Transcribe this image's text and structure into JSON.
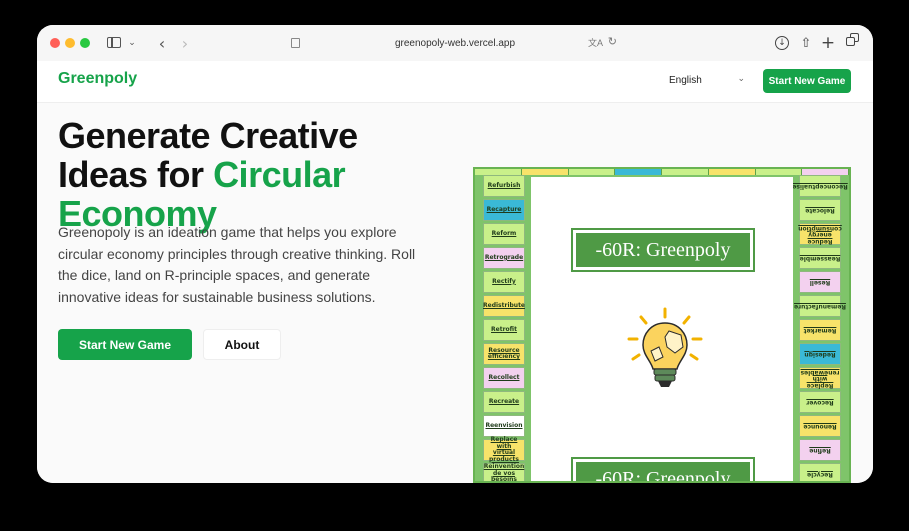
{
  "browser": {
    "url": "greenopoly-web.vercel.app",
    "icons": [
      "sidebar-icon",
      "chevron-down-icon",
      "back-icon",
      "forward-icon",
      "page-icon",
      "translate-icon",
      "reload-icon",
      "download-icon",
      "share-icon",
      "plus-icon",
      "tabs-icon"
    ]
  },
  "header": {
    "logo": "Greenpoly",
    "language": "English",
    "cta": "Start New Game"
  },
  "hero": {
    "title_line1": "Generate Creative",
    "title_line2_a": "Ideas for ",
    "title_line2_b": "Circular",
    "title_line3": "Economy",
    "description": "Greenopoly is an ideation game that helps you explore circular economy principles through creative thinking. Roll the dice, land on R-principle spaces, and generate innovative ideas for sustainable business solutions.",
    "primary_button": "Start New Game",
    "secondary_button": "About"
  },
  "board": {
    "label": "-60R: Greenpoly",
    "left_tiles": [
      {
        "text": "Refurbish",
        "color": "#c9f08a"
      },
      {
        "text": "Recapture",
        "color": "#3ab9d6"
      },
      {
        "text": "Reform",
        "color": "#c9f08a"
      },
      {
        "text": "Retrograde",
        "color": "#f3d1ef"
      },
      {
        "text": "Rectify",
        "color": "#c9f08a"
      },
      {
        "text": "Redistribute",
        "color": "#f7e36a"
      },
      {
        "text": "Retrofit",
        "color": "#c9f08a"
      },
      {
        "text": "Resource efficiency",
        "color": "#f7e36a"
      },
      {
        "text": "Recollect",
        "color": "#f3d1ef"
      },
      {
        "text": "Recreate",
        "color": "#c9f08a"
      },
      {
        "text": "Reenvision",
        "color": "#ffffff"
      },
      {
        "text": "Replace with virtual products",
        "color": "#f7e36a"
      },
      {
        "text": "Reinvention de vos besoins",
        "color": "#c9f08a"
      }
    ],
    "right_tiles": [
      {
        "text": "Reconceptualise",
        "color": "#c9f08a"
      },
      {
        "text": "Relocate",
        "color": "#c9f08a"
      },
      {
        "text": "Reduce energy consumption",
        "color": "#f7e36a"
      },
      {
        "text": "Reassemble",
        "color": "#c9f08a"
      },
      {
        "text": "Resell",
        "color": "#f3d1ef"
      },
      {
        "text": "Remanufacture",
        "color": "#c9f08a"
      },
      {
        "text": "Remarket",
        "color": "#f7e36a"
      },
      {
        "text": "Redesign",
        "color": "#3ab9d6"
      },
      {
        "text": "Replace with renewables",
        "color": "#f7e36a"
      },
      {
        "text": "Recover",
        "color": "#c9f08a"
      },
      {
        "text": "Renounce",
        "color": "#f7e36a"
      },
      {
        "text": "Refine",
        "color": "#f3d1ef"
      },
      {
        "text": "Recycle",
        "color": "#c9f08a"
      }
    ]
  }
}
